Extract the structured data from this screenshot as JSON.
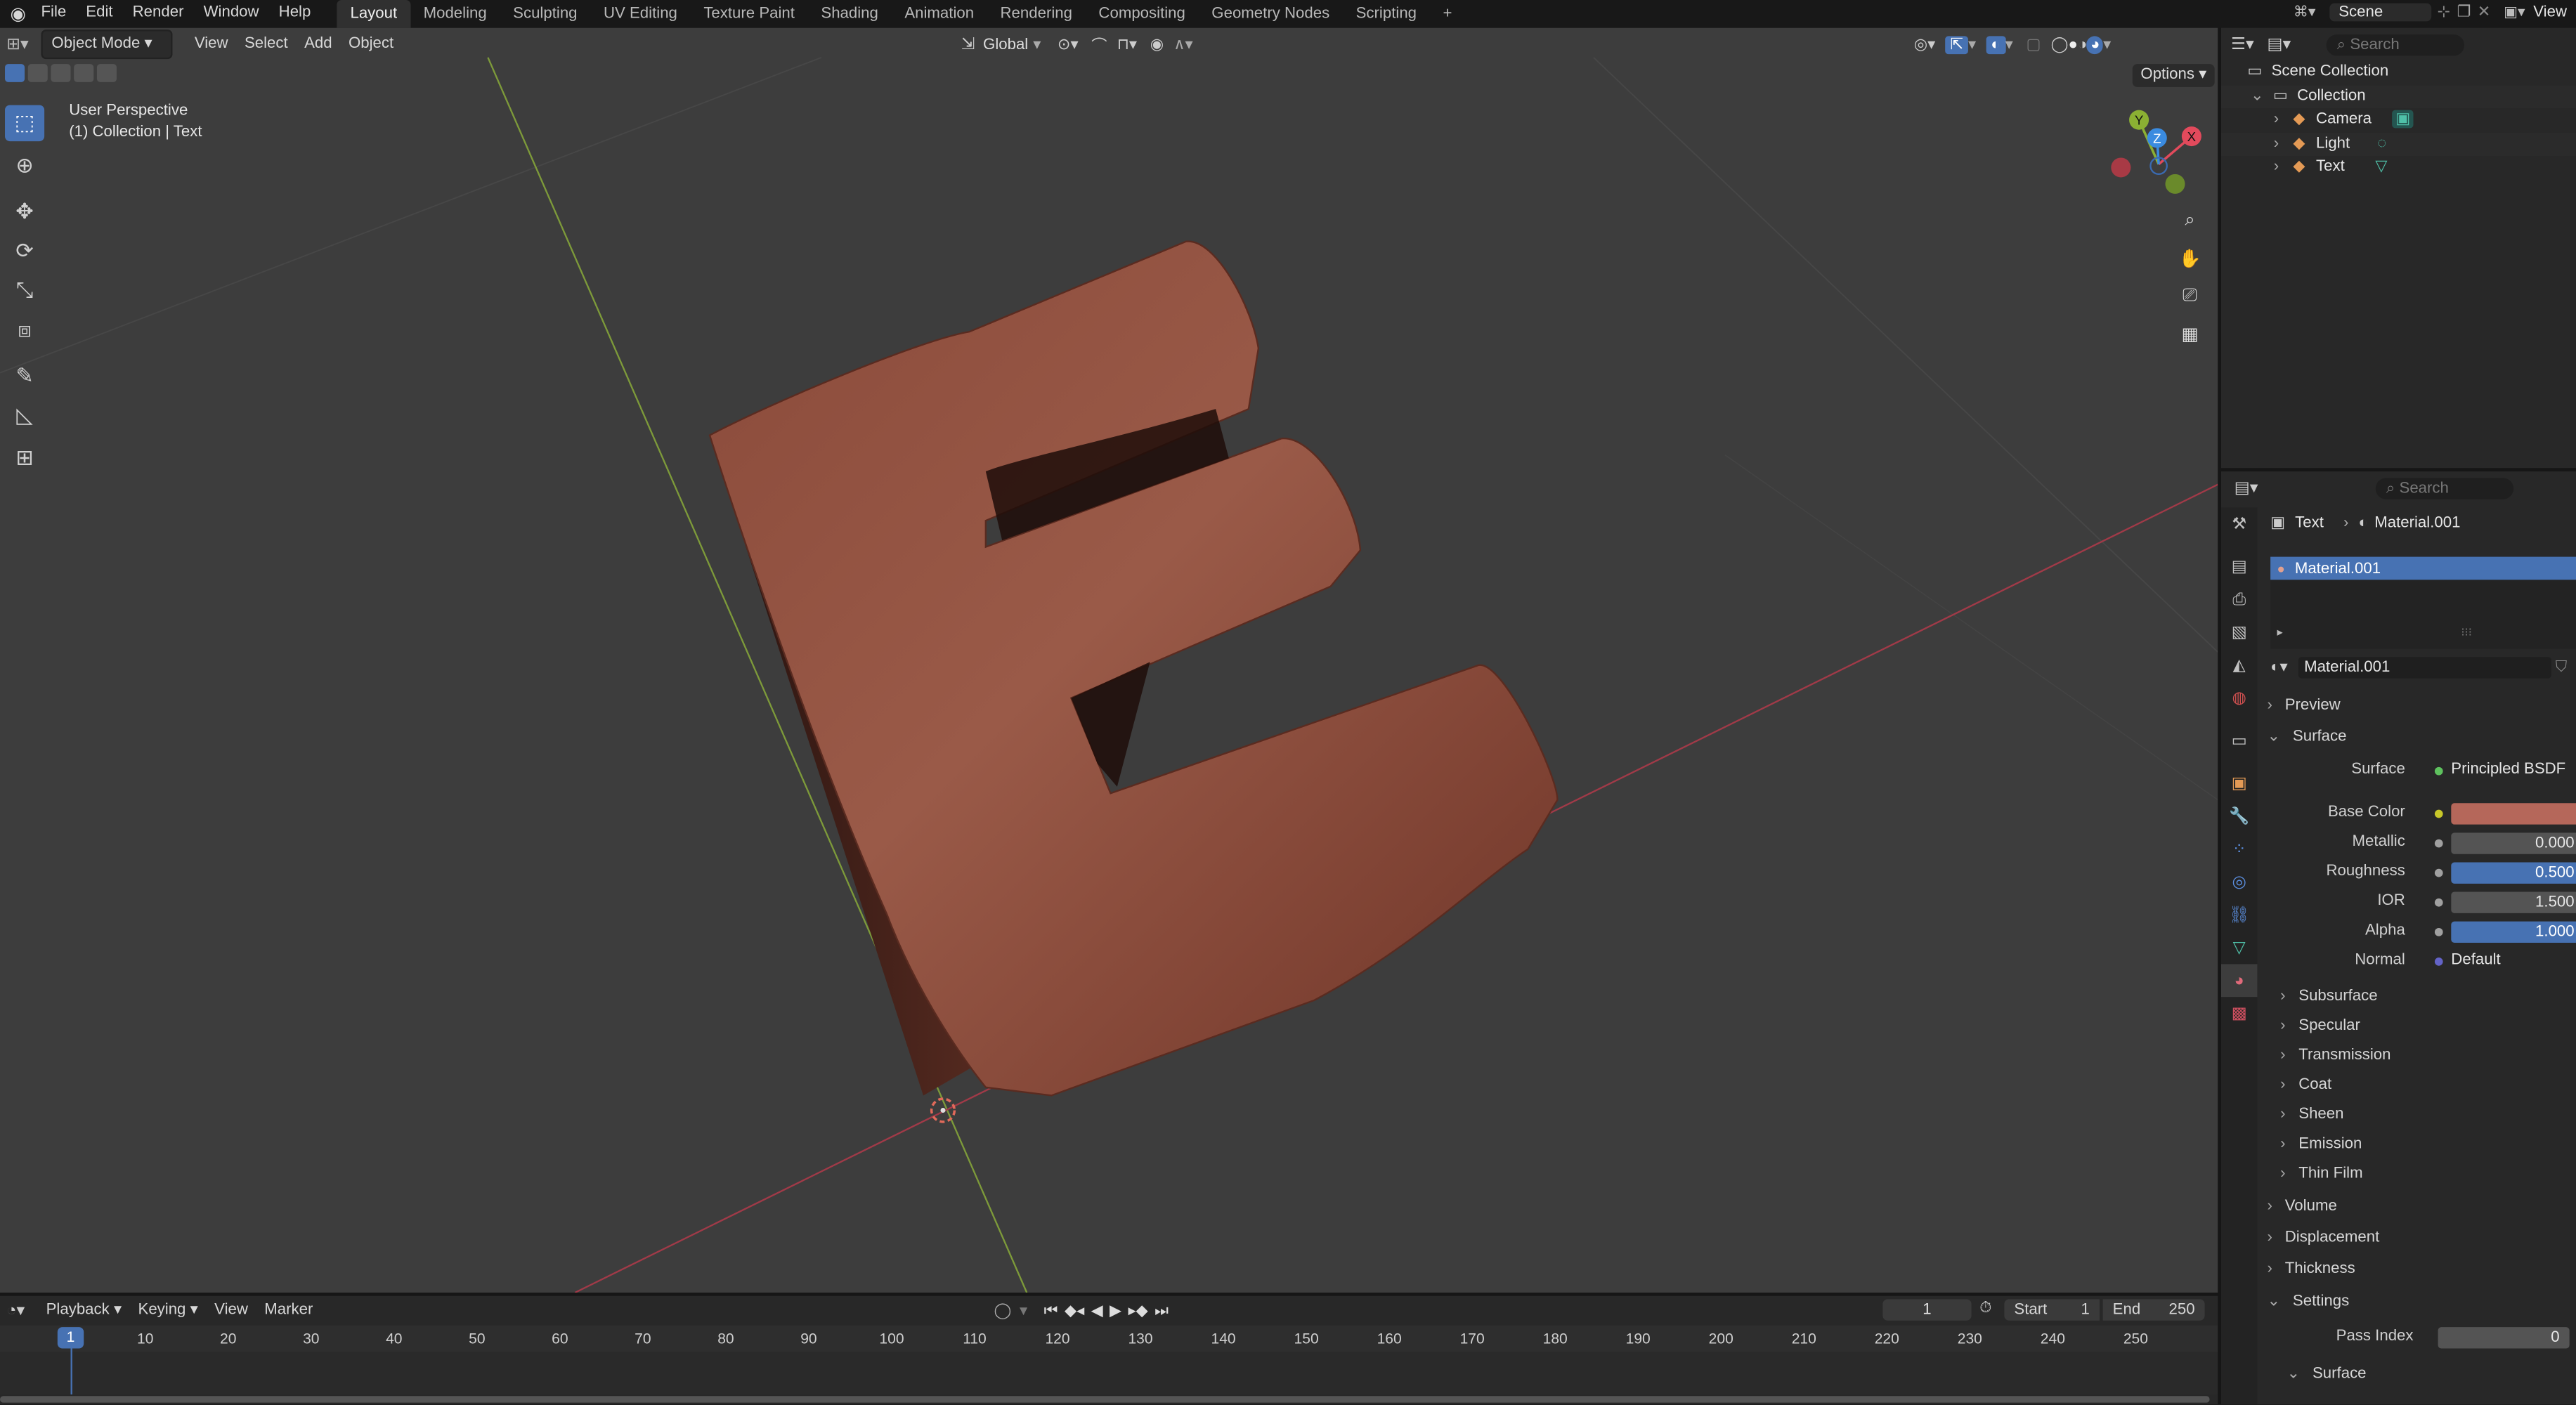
{
  "topbar": {
    "menus": [
      "File",
      "Edit",
      "Render",
      "Window",
      "Help"
    ],
    "workspaces": [
      "Layout",
      "Modeling",
      "Sculpting",
      "UV Editing",
      "Texture Paint",
      "Shading",
      "Animation",
      "Rendering",
      "Compositing",
      "Geometry Nodes",
      "Scripting"
    ],
    "active_workspace": "Layout",
    "add_tab": "+",
    "scene_name": "Scene",
    "view_layer": "View"
  },
  "viewport": {
    "mode": "Object Mode",
    "menus": [
      "View",
      "Select",
      "Add",
      "Object"
    ],
    "orientation": "Global",
    "options": "Options",
    "info_line1": "User Perspective",
    "info_line2": "(1) Collection | Text",
    "gizmo_axes": {
      "x": "X",
      "y": "Y",
      "z": "Z"
    }
  },
  "outliner": {
    "search_placeholder": "Search",
    "scene_collection": "Scene Collection",
    "collection": "Collection",
    "items": [
      "Camera",
      "Light",
      "Text"
    ]
  },
  "properties": {
    "search_placeholder": "Search",
    "breadcrumb_object": "Text",
    "breadcrumb_material": "Material.001",
    "slot_name": "Material.001",
    "material_name": "Material.001",
    "panels": {
      "preview": "Preview",
      "surface": "Surface",
      "volume": "Volume",
      "displacement": "Displacement",
      "thickness": "Thickness",
      "settings": "Settings",
      "settings_surface": "Surface"
    },
    "surface_label": "Surface",
    "surface_value": "Principled BSDF",
    "fields": [
      {
        "label": "Base Color",
        "value": ""
      },
      {
        "label": "Metallic",
        "value": "0.000"
      },
      {
        "label": "Roughness",
        "value": "0.500"
      },
      {
        "label": "IOR",
        "value": "1.500"
      },
      {
        "label": "Alpha",
        "value": "1.000"
      },
      {
        "label": "Normal",
        "value": "Default"
      }
    ],
    "subpanels": [
      "Subsurface",
      "Specular",
      "Transmission",
      "Coat",
      "Sheen",
      "Emission",
      "Thin Film"
    ],
    "pass_index_label": "Pass Index",
    "pass_index_value": "0",
    "base_color_hex": "#b5675a"
  },
  "timeline": {
    "menus": [
      "Playback",
      "Keying",
      "View",
      "Marker"
    ],
    "current_frame": "1",
    "start_label": "Start",
    "start_value": "1",
    "end_label": "End",
    "end_value": "250",
    "ticks": [
      "1",
      "10",
      "20",
      "30",
      "40",
      "50",
      "60",
      "70",
      "80",
      "90",
      "100",
      "110",
      "120",
      "130",
      "140",
      "150",
      "160",
      "170",
      "180",
      "190",
      "200",
      "210",
      "220",
      "230",
      "240",
      "250"
    ]
  },
  "colors": {
    "accent": "#4772b3",
    "viewport_bg": "#3d3d3d",
    "object_brown": "#7a3d30"
  }
}
